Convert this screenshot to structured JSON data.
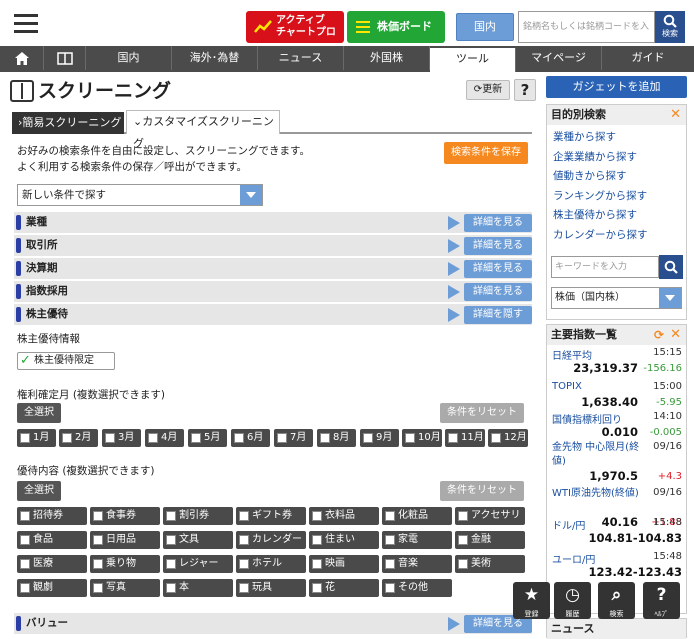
{
  "header": {
    "active_chart_label_1": "アクティブ",
    "active_chart_label_2": "チャートプロ",
    "stock_board_label": "株価ボード",
    "market_toggle": "国内",
    "search_placeholder": "銘柄名もしくは銘柄コードを入力",
    "search_button": "検索"
  },
  "nav": {
    "items": [
      "国内",
      "海外･為替",
      "ニュース",
      "外国株",
      "ツール",
      "マイページ",
      "ガイド"
    ],
    "active": "ツール"
  },
  "page": {
    "title": "スクリーニング",
    "refresh": "更新",
    "help": "?",
    "tab_simple": "簡易スクリーニング",
    "tab_custom": "カスタマイズスクリーニング",
    "desc_line1": "お好みの検索条件を自由に設定し、スクリーニングできます。",
    "desc_line2": "よく利用する検索条件の保存／呼出ができます。",
    "save_button": "検索条件を保存",
    "condition_select": "新しい条件で探す"
  },
  "criteria": [
    {
      "label": "業種",
      "action": "詳細を見る"
    },
    {
      "label": "取引所",
      "action": "詳細を見る"
    },
    {
      "label": "決算期",
      "action": "詳細を見る"
    },
    {
      "label": "指数採用",
      "action": "詳細を見る"
    },
    {
      "label": "株主優待",
      "action": "詳細を隠す"
    }
  ],
  "yutai": {
    "info_label": "株主優待情報",
    "limited_label": "株主優待限定",
    "limited_checked": true,
    "month_label": "権利確定月 (複数選択できます)",
    "select_all": "全選択",
    "reset": "条件をリセット",
    "months": [
      "1月",
      "2月",
      "3月",
      "4月",
      "5月",
      "6月",
      "7月",
      "8月",
      "9月",
      "10月",
      "11月",
      "12月"
    ],
    "content_label": "優待内容 (複数選択できます)",
    "contents": [
      "招待券",
      "食事券",
      "割引券",
      "ギフト券",
      "衣料品",
      "化粧品",
      "アクセサリ",
      "食品",
      "日用品",
      "文具",
      "カレンダー",
      "住まい",
      "家電",
      "金融",
      "医療",
      "乗り物",
      "レジャー",
      "ホテル",
      "映画",
      "音楽",
      "美術",
      "観劇",
      "写真",
      "本",
      "玩具",
      "花",
      "その他"
    ]
  },
  "value_row": {
    "label": "バリュー",
    "action": "詳細を見る"
  },
  "sidebar": {
    "gadget_button": "ガジェットを追加",
    "purpose_title": "目的別検索",
    "purpose_links": [
      "業種から探す",
      "企業業績から探す",
      "値動きから探す",
      "ランキングから探す",
      "株主優待から探す",
      "カレンダーから探す"
    ],
    "keyword_placeholder": "キーワードを入力",
    "keyword_select": "株価（国内株）",
    "indices_title": "主要指数一覧",
    "indices": [
      {
        "name": "日経平均",
        "time": "15:15",
        "value": "23,319.37",
        "change": "-156.16",
        "dir": "down"
      },
      {
        "name": "TOPIX",
        "time": "15:00",
        "value": "1,638.40",
        "change": "-5.95",
        "dir": "down"
      },
      {
        "name": "国債指標利回り",
        "time": "14:10",
        "value": "0.010",
        "change": "-0.005",
        "dir": "down"
      },
      {
        "name": "金先物 中心限月(終値)",
        "time": "09/16",
        "value": "1,970.5",
        "change": "+4.3",
        "dir": "up"
      },
      {
        "name": "WTI原油先物(終値)",
        "time": "09/16",
        "value": "40.16",
        "change": "+1.88",
        "dir": "up"
      },
      {
        "name": "ドル/円",
        "time": "15:48",
        "value": "104.81-104.83",
        "change": "",
        "dir": ""
      },
      {
        "name": "ユーロ/円",
        "time": "15:48",
        "value": "123.42-123.43",
        "change": "",
        "dir": ""
      }
    ],
    "news_title": "ニュース"
  },
  "footer_buttons": [
    {
      "icon": "star-icon",
      "label": "登録"
    },
    {
      "icon": "history-icon",
      "label": "履歴"
    },
    {
      "icon": "search-icon",
      "label": "検索"
    },
    {
      "icon": "help-icon",
      "label": "ﾍﾙﾌﾟ"
    }
  ],
  "colors": {
    "up": "#e0202a",
    "down": "#3a9a3a",
    "accent": "#2a63b5",
    "orange": "#f5891f"
  }
}
